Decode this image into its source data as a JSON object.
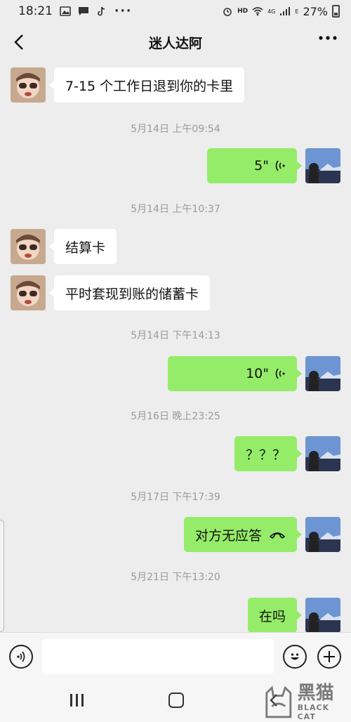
{
  "status_bar": {
    "time": "18:21",
    "network": "HD",
    "signal_4g": "4G",
    "signal_e": "E",
    "battery": "27%",
    "icons": [
      "image-icon",
      "message-icon",
      "tiktok-icon",
      "more-dots-icon",
      "alarm-icon",
      "wifi-icon",
      "battery-icon"
    ]
  },
  "header": {
    "title": "迷人达阿",
    "back_icon": "chevron-left-icon",
    "more_icon": "more-icon"
  },
  "messages": [
    {
      "side": "left",
      "type": "text",
      "text": "7-15 个工作日退到你的卡里"
    },
    {
      "type": "time",
      "text": "5月14日 上午09:54"
    },
    {
      "side": "right",
      "type": "voice",
      "duration": "5\""
    },
    {
      "type": "time",
      "text": "5月14日 上午10:37"
    },
    {
      "side": "left",
      "type": "text",
      "text": "结算卡"
    },
    {
      "side": "left",
      "type": "text",
      "text": "平时套现到账的储蓄卡"
    },
    {
      "type": "time",
      "text": "5月14日 下午14:13"
    },
    {
      "side": "right",
      "type": "voice",
      "duration": "10\""
    },
    {
      "type": "time",
      "text": "5月16日 晚上23:25"
    },
    {
      "side": "right",
      "type": "text",
      "text": "？？？"
    },
    {
      "type": "time",
      "text": "5月17日 下午17:39"
    },
    {
      "side": "right",
      "type": "call",
      "text": "对方无应答"
    },
    {
      "type": "time",
      "text": "5月21日 下午13:20"
    },
    {
      "side": "right",
      "type": "text",
      "text": "在吗"
    }
  ],
  "input_bar": {
    "voice_icon": "voice-input-icon",
    "emoji_icon": "emoji-icon",
    "plus_icon": "plus-icon",
    "placeholder": ""
  },
  "nav_bar": {
    "recent_icon": "recent-apps-icon",
    "home_icon": "home-icon",
    "back_icon": "nav-back-icon"
  },
  "watermark": {
    "cn": "黑猫",
    "en": "BLACK CAT"
  },
  "colors": {
    "background": "#ededed",
    "green_bubble": "#95ec69",
    "white_bubble": "#ffffff",
    "timestamp": "#9a9a9a"
  }
}
